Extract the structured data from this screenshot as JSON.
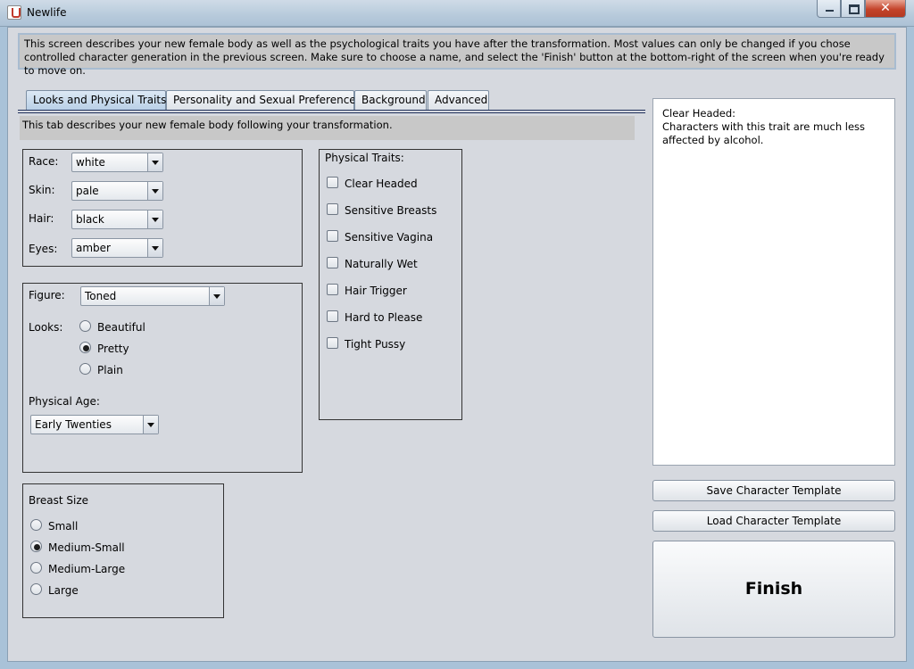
{
  "window": {
    "title": "Newlife",
    "close_glyph": "✕"
  },
  "intro": "This screen describes your new female body as well as the psychological traits you have after the transformation. Most values can only be changed if you chose controlled character generation in the previous screen. Make sure to choose a name, and select the 'Finish' button at the bottom-right of the screen when you're ready to move on.",
  "tabs": [
    "Looks and Physical Traits",
    "Personality and Sexual Preferences",
    "Background",
    "Advanced"
  ],
  "tab_description": "This tab describes your new female body following your transformation.",
  "appearance": {
    "race": {
      "label": "Race:",
      "value": "white"
    },
    "skin": {
      "label": "Skin:",
      "value": "pale"
    },
    "hair": {
      "label": "Hair:",
      "value": "black"
    },
    "eyes": {
      "label": "Eyes:",
      "value": "amber"
    }
  },
  "figure": {
    "label": "Figure:",
    "value": "Toned",
    "looks_label": "Looks:",
    "looks": [
      "Beautiful",
      "Pretty",
      "Plain"
    ],
    "looks_selected": "Pretty",
    "age_label": "Physical Age:",
    "age_value": "Early Twenties"
  },
  "breast": {
    "title": "Breast Size",
    "options": [
      "Small",
      "Medium-Small",
      "Medium-Large",
      "Large"
    ],
    "selected": "Medium-Small"
  },
  "traits": {
    "title": "Physical Traits:",
    "items": [
      "Clear Headed",
      "Sensitive Breasts",
      "Sensitive Vagina",
      "Naturally Wet",
      "Hair Trigger",
      "Hard to Please",
      "Tight Pussy"
    ]
  },
  "description": {
    "heading": "Clear Headed:",
    "body": "Characters with this trait are much less affected by alcohol."
  },
  "buttons": {
    "save": "Save Character Template",
    "load": "Load Character Template",
    "finish": "Finish"
  },
  "colors": {
    "panel_bg": "#d6d9df",
    "info_bg": "#c8c8c8",
    "active_tab": "#b8cfe6"
  }
}
